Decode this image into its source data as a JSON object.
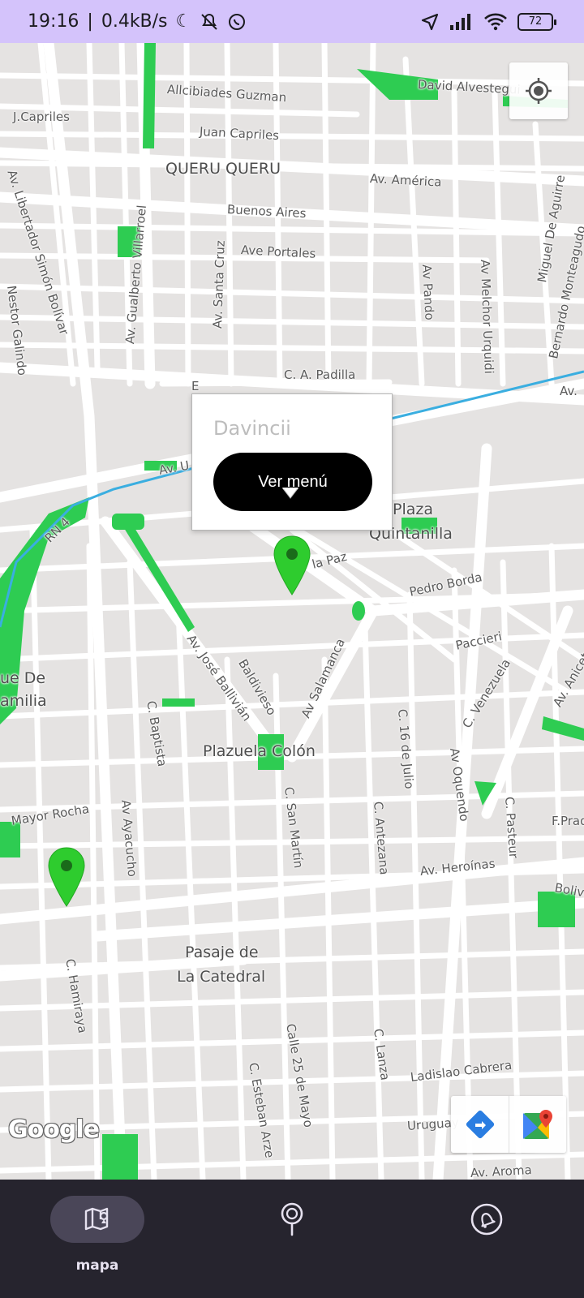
{
  "status_bar": {
    "time": "19:16",
    "network_speed": "0.4kB/s",
    "battery": "72",
    "icons": [
      "moon-icon",
      "muted-bell-icon",
      "whatsapp-icon",
      "navigation-arrow-icon",
      "signal-icon",
      "wifi-icon",
      "battery-icon"
    ]
  },
  "map": {
    "street_labels": [
      {
        "text": "Allcibiades Guzman"
      },
      {
        "text": "David Alvestegui"
      },
      {
        "text": "J.Capriles"
      },
      {
        "text": "Juan Capriles"
      },
      {
        "text": "QUERU QUERU"
      },
      {
        "text": "Av. América"
      },
      {
        "text": "Buenos Aires"
      },
      {
        "text": "Ave Portales"
      },
      {
        "text": "Av. Libertador Simón Bolívar"
      },
      {
        "text": "Av. Gualberto Villarroel"
      },
      {
        "text": "Av. Santa Cruz"
      },
      {
        "text": "Nestor Galindo"
      },
      {
        "text": "Av Pando"
      },
      {
        "text": "Av Melchor Urquidi"
      },
      {
        "text": "Miguel De Aguirre"
      },
      {
        "text": "Bernardo Monteagudo"
      },
      {
        "text": "C. A. Padilla"
      },
      {
        "text": "Av."
      },
      {
        "text": "Av. U"
      },
      {
        "text": "E"
      },
      {
        "text": "RN 4"
      },
      {
        "text": "Plaza"
      },
      {
        "text": "Quintanilla"
      },
      {
        "text": "la Paz"
      },
      {
        "text": "Pedro Borda"
      },
      {
        "text": "Paccieri"
      },
      {
        "text": "Av. José Ballivián"
      },
      {
        "text": "Baldivieso"
      },
      {
        "text": "Av Salamanca"
      },
      {
        "text": "C. 16 de Julio"
      },
      {
        "text": "C. Venezuela"
      },
      {
        "text": "Av. Anicet"
      },
      {
        "text": "ue De"
      },
      {
        "text": "amilia"
      },
      {
        "text": "C. Baptista"
      },
      {
        "text": "Plazuela Colón"
      },
      {
        "text": "C. San Martín"
      },
      {
        "text": "Av Oquendo"
      },
      {
        "text": "C. Pasteur"
      },
      {
        "text": "Mayor Rocha"
      },
      {
        "text": "Av Ayacucho"
      },
      {
        "text": "C. Antezana"
      },
      {
        "text": "Av. Heroínas"
      },
      {
        "text": "F.Prad"
      },
      {
        "text": "Boliva"
      },
      {
        "text": "C. Hamiraya"
      },
      {
        "text": "Pasaje de"
      },
      {
        "text": "La Catedral"
      },
      {
        "text": "Calle 25 de Mayo"
      },
      {
        "text": "C. Esteban Arze"
      },
      {
        "text": "C. Lanza"
      },
      {
        "text": "Ladislao Cabrera"
      },
      {
        "text": "Uruguay"
      },
      {
        "text": "Av. Aroma"
      }
    ],
    "info_window": {
      "title": "Davincii",
      "button_label": "Ver menú"
    },
    "marker_color": "#2ecc2e",
    "park_color": "#2ecc52",
    "rail_color": "#3aaee0",
    "google_logo": "Google"
  },
  "bottom_nav": {
    "items": [
      {
        "label": "mapa",
        "icon": "map-icon",
        "active": true
      },
      {
        "label": "",
        "icon": "location-pin-icon",
        "active": false
      },
      {
        "label": "",
        "icon": "bell-icon",
        "active": false
      }
    ]
  }
}
